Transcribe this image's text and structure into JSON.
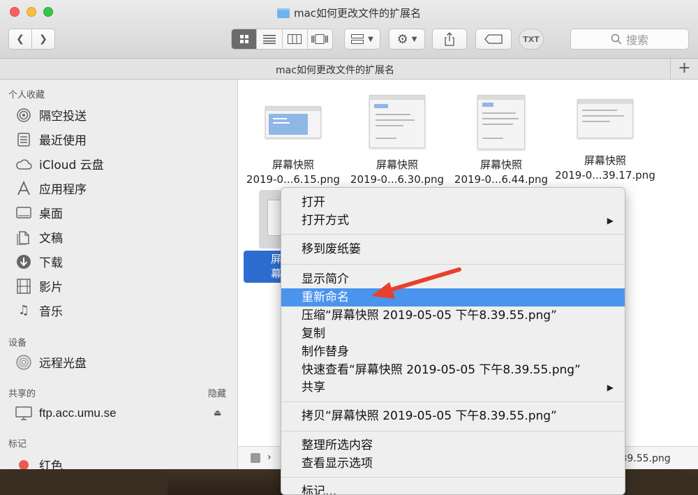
{
  "window": {
    "title": "mac如何更改文件的扩展名"
  },
  "toolbar": {
    "back_icon": "chevron-left",
    "forward_icon": "chevron-right",
    "view_modes": [
      "icon-view",
      "list-view",
      "column-view",
      "gallery-view"
    ],
    "group_by": "grid-group",
    "action": "gear",
    "share": "share",
    "tag": "tag",
    "txt_label": "TXT",
    "search_placeholder": "搜索"
  },
  "pathbar": {
    "title": "mac如何更改文件的扩展名",
    "add_tab": "+"
  },
  "sidebar": {
    "favorites_header": "个人收藏",
    "favorites": [
      {
        "label": "隔空投送",
        "icon": "airdrop-icon"
      },
      {
        "label": "最近使用",
        "icon": "recents-icon"
      },
      {
        "label": "iCloud 云盘",
        "icon": "cloud-icon"
      },
      {
        "label": "应用程序",
        "icon": "applications-icon"
      },
      {
        "label": "桌面",
        "icon": "desktop-icon"
      },
      {
        "label": "文稿",
        "icon": "documents-icon"
      },
      {
        "label": "下载",
        "icon": "downloads-icon"
      },
      {
        "label": "影片",
        "icon": "movies-icon"
      },
      {
        "label": "音乐",
        "icon": "music-icon"
      }
    ],
    "devices_header": "设备",
    "devices": [
      {
        "label": "远程光盘",
        "icon": "disc-icon"
      }
    ],
    "shared_header": "共享的",
    "shared_hide": "隐藏",
    "shared": [
      {
        "label": "ftp.acc.umu.se",
        "icon": "server-icon"
      }
    ],
    "tags_header": "标记",
    "tags": [
      {
        "label": "红色",
        "color": "#f0574f"
      }
    ]
  },
  "files": [
    {
      "line1": "屏幕快照",
      "line2": "2019-0...6.15.png"
    },
    {
      "line1": "屏幕快照",
      "line2": "2019-0...6.30.png"
    },
    {
      "line1": "屏幕快照",
      "line2": "2019-0...6.44.png"
    },
    {
      "line1": "屏幕快照",
      "line2": "2019-0...39.17.png"
    }
  ],
  "selected_file": {
    "line1": "屏幕",
    "line2": "2019-0"
  },
  "statusbar": {
    "filename_tail": ".39.55.png"
  },
  "context_menu": {
    "highlight_color": "#4b94ee",
    "items": [
      {
        "label": "打开"
      },
      {
        "label": "打开方式",
        "submenu": "▶"
      },
      {
        "label": "移到废纸篓"
      },
      {
        "label": "显示简介"
      },
      {
        "label": "重新命名"
      },
      {
        "label": "压缩“屏幕快照 2019-05-05 下午8.39.55.png”"
      },
      {
        "label": "复制"
      },
      {
        "label": "制作替身"
      },
      {
        "label": "快速查看“屏幕快照 2019-05-05 下午8.39.55.png”"
      },
      {
        "label": "共享",
        "submenu": "▶"
      },
      {
        "label": "拷贝“屏幕快照 2019-05-05 下午8.39.55.png”"
      },
      {
        "label": "整理所选内容"
      },
      {
        "label": "查看显示选项"
      },
      {
        "label": "标记..."
      }
    ]
  },
  "annotation": {
    "arrow_color": "#e8402c"
  }
}
